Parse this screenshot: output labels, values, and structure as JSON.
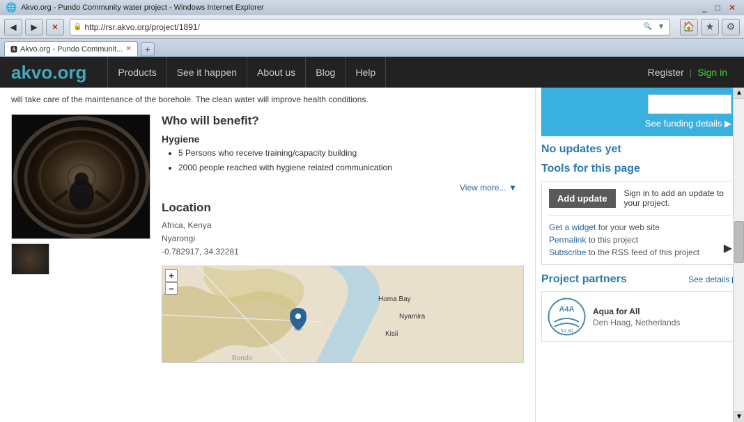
{
  "browser": {
    "title": "Akvo.org - Pundo Community water project - Windows Internet Explorer",
    "url": "http://rsr.akvo.org/project/1891/",
    "tab_label": "Akvo.org - Pundo Communit...",
    "favicon": "e"
  },
  "nav": {
    "logo_text": "akvo",
    "logo_tld": ".org",
    "items": [
      "Products",
      "See it happen",
      "About us",
      "Blog",
      "Help"
    ],
    "register": "Register",
    "signin": "Sign in"
  },
  "main": {
    "intro_text": "will take care of the maintenance of the borehole. The clean water will improve health conditions.",
    "who_will_benefit": "Who will benefit?",
    "hygiene": "Hygiene",
    "benefit_items": [
      "5 Persons who receive training/capacity building",
      "2000 people reached with hygiene related communication"
    ],
    "view_more": "View more...",
    "location_heading": "Location",
    "location_country": "Africa, Kenya",
    "location_city": "Nyarongi",
    "location_coords": "-0.782917, 34.32281",
    "map_zoom_in": "+",
    "map_zoom_out": "−"
  },
  "sidebar": {
    "funding_link": "See funding details ▶",
    "no_updates": "No updates yet",
    "tools_heading": "Tools for this page",
    "add_update_btn": "Add update",
    "sign_in_text": "Sign in to add an update to your project.",
    "tools_links": [
      {
        "label": "Get a widget",
        "rest": " for your web site"
      },
      {
        "label": "Permalink",
        "rest": " to this project"
      },
      {
        "label": "Subscribe",
        "rest": " to the RSS feed of this project"
      }
    ],
    "partners_heading": "Project partners",
    "see_details": "See details ▶",
    "partner_name": "Aqua for All",
    "partner_location": "Den Haag, Netherlands"
  }
}
